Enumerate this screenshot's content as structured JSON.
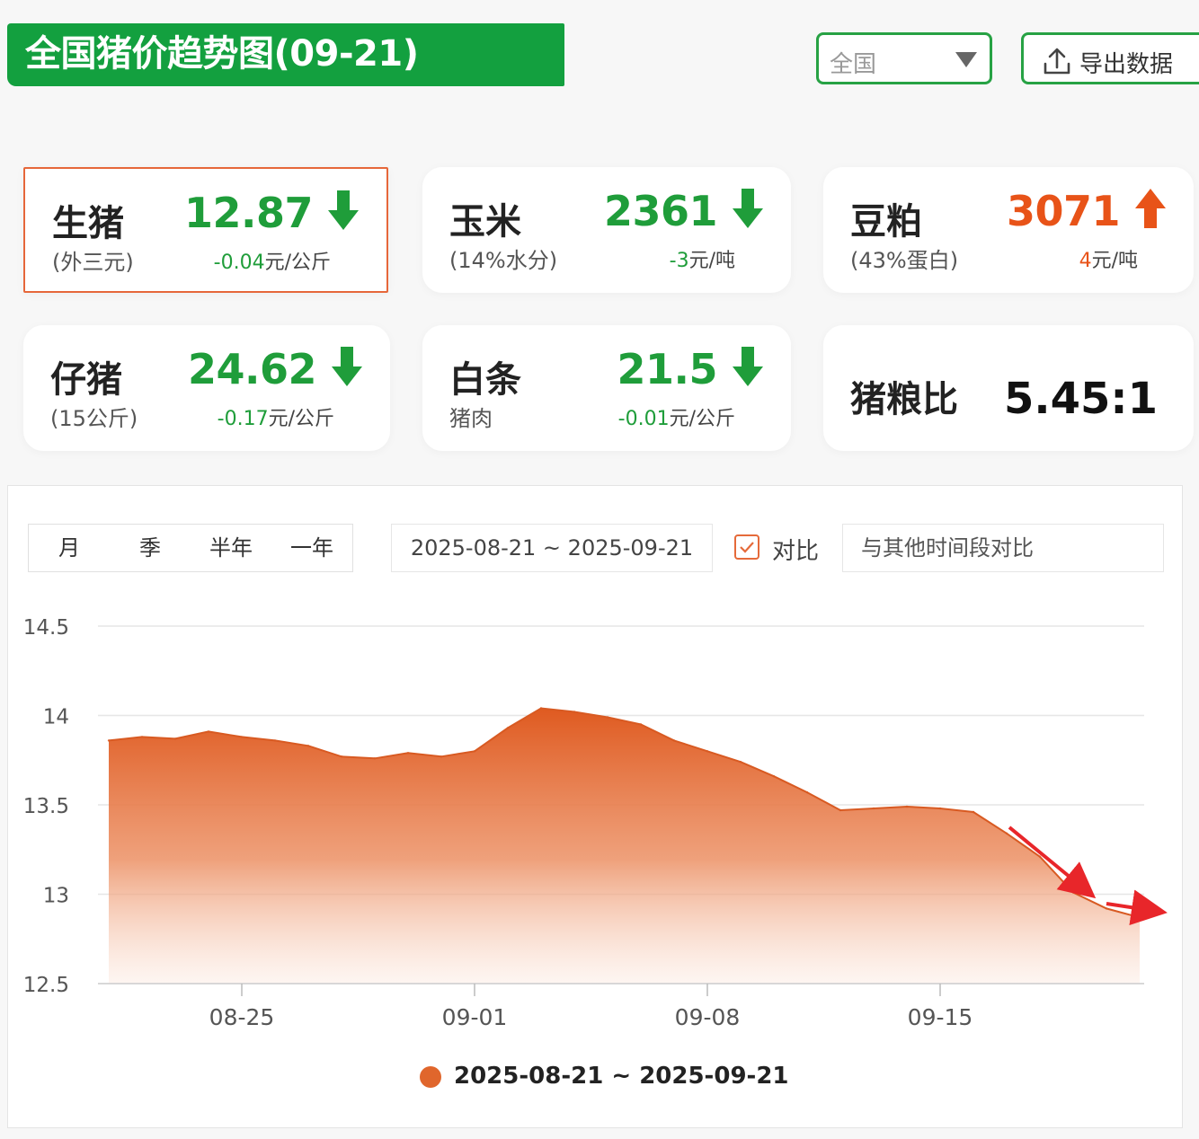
{
  "header": {
    "title": "全国猪价趋势图(09-21)",
    "region_value": "全国",
    "export_label": "导出数据"
  },
  "cards": [
    {
      "name": "生猪",
      "sub": "(外三元)",
      "price": "12.87",
      "direction": "down",
      "change": "-0.04",
      "unit": "元/公斤",
      "active": true
    },
    {
      "name": "玉米",
      "sub": "(14%水分)",
      "price": "2361",
      "direction": "down",
      "change": "-3",
      "unit": "元/吨",
      "active": false
    },
    {
      "name": "豆粕",
      "sub": "(43%蛋白)",
      "price": "3071",
      "direction": "up",
      "change": "4",
      "unit": "元/吨",
      "active": false
    },
    {
      "name": "仔猪",
      "sub": "(15公斤)",
      "price": "24.62",
      "direction": "down",
      "change": "-0.17",
      "unit": "元/公斤",
      "active": false
    },
    {
      "name": "白条",
      "sub": "猪肉",
      "price": "21.5",
      "direction": "down",
      "change": "-0.01",
      "unit": "元/公斤",
      "active": false
    }
  ],
  "ratio_card": {
    "name": "猪粮比",
    "value": "5.45:1"
  },
  "controls": {
    "tabs": [
      "月",
      "季",
      "半年",
      "一年"
    ],
    "active_tab": "月",
    "date_range": "2025-08-21 ~ 2025-09-21",
    "compare_label": "对比",
    "compare_placeholder": "与其他时间段对比"
  },
  "colors": {
    "brand_green": "#13a03f",
    "down_green": "#1f9d3a",
    "up_orange": "#e85318",
    "series_orange": "#e0662c",
    "annotation_red": "#e8262a"
  },
  "chart_data": {
    "type": "area",
    "title": "",
    "xlabel": "",
    "ylabel": "",
    "ylim": [
      12.5,
      14.5
    ],
    "yticks": [
      "14.5",
      "14",
      "13.5",
      "13",
      "12.5"
    ],
    "xtick_labels": [
      "08-25",
      "09-01",
      "09-08",
      "09-15"
    ],
    "x": [
      "08-21",
      "08-22",
      "08-23",
      "08-24",
      "08-25",
      "08-26",
      "08-27",
      "08-28",
      "08-29",
      "08-30",
      "08-31",
      "09-01",
      "09-02",
      "09-03",
      "09-04",
      "09-05",
      "09-06",
      "09-07",
      "09-08",
      "09-09",
      "09-10",
      "09-11",
      "09-12",
      "09-13",
      "09-14",
      "09-15",
      "09-16",
      "09-17",
      "09-18",
      "09-19",
      "09-20",
      "09-21"
    ],
    "series": [
      {
        "name": "2025-08-21 ~ 2025-09-21",
        "values": [
          13.86,
          13.88,
          13.87,
          13.91,
          13.88,
          13.86,
          13.83,
          13.77,
          13.76,
          13.79,
          13.77,
          13.8,
          13.93,
          14.04,
          14.02,
          13.99,
          13.95,
          13.86,
          13.8,
          13.74,
          13.66,
          13.57,
          13.47,
          13.48,
          13.49,
          13.48,
          13.46,
          13.34,
          13.21,
          13.01,
          12.92,
          12.87
        ]
      }
    ],
    "legend": "bottom-center",
    "grid": true
  }
}
